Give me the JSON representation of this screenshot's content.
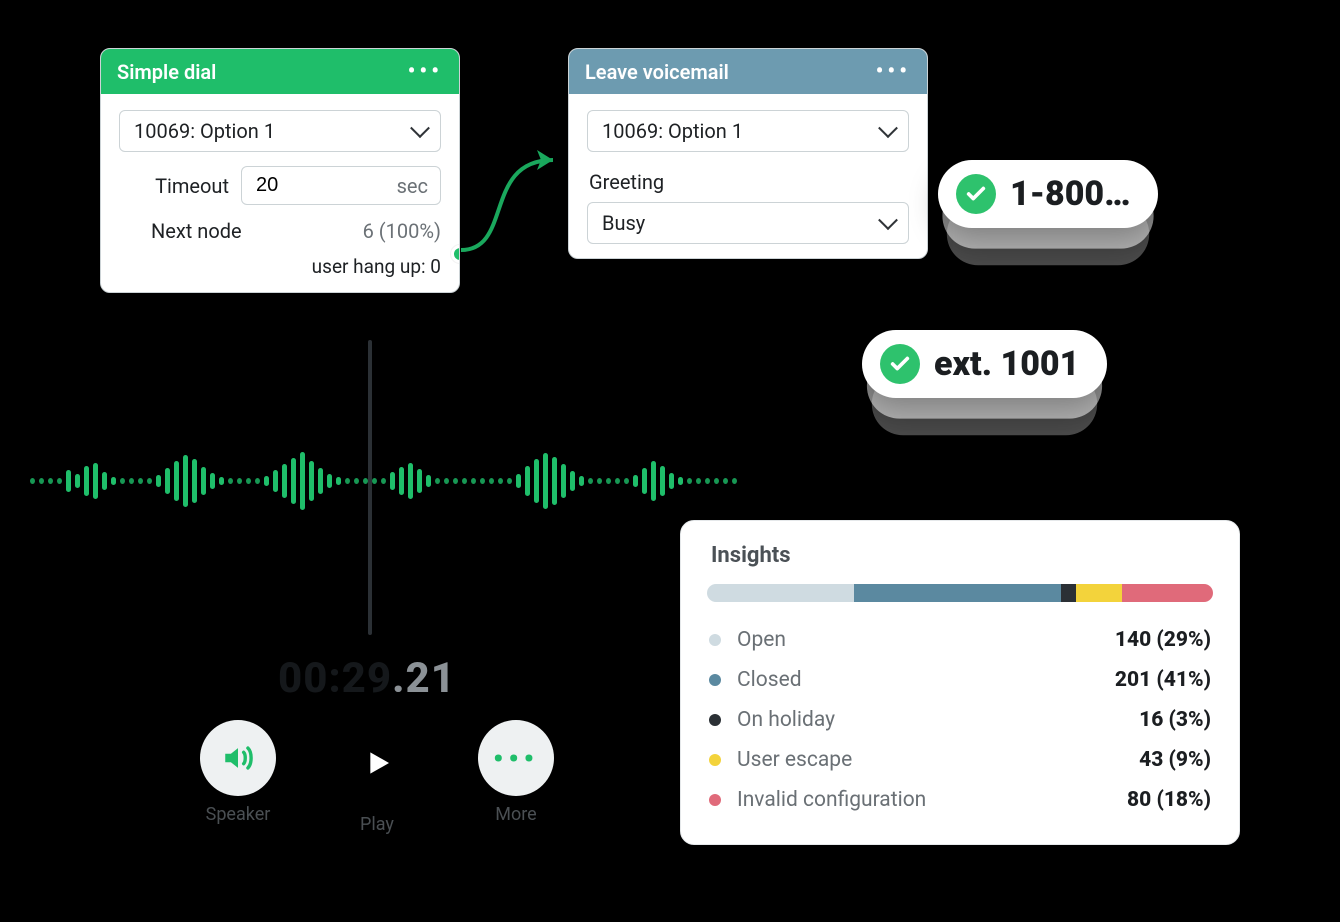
{
  "nodes": {
    "simple_dial": {
      "title": "Simple dial",
      "option": "10069: Option 1",
      "timeout_label": "Timeout",
      "timeout_value": "20",
      "timeout_unit": "sec",
      "next_node_label": "Next node",
      "next_node_value": "6 (100%)",
      "hangup": "user hang up: 0"
    },
    "voicemail": {
      "title": "Leave voicemail",
      "option": "10069: Option 1",
      "greeting_label": "Greeting",
      "greeting_value": "Busy"
    }
  },
  "pills": {
    "number": "1-800…",
    "ext": "ext. 1001"
  },
  "timer": {
    "mmss": "00:29",
    "ms": ".21"
  },
  "player": {
    "speaker": "Speaker",
    "play": "Play",
    "more": "More"
  },
  "insights": {
    "title": "Insights",
    "items": [
      {
        "name": "Open",
        "value": "140 (29%)",
        "pct": 29,
        "color": "#cfdbe1"
      },
      {
        "name": "Closed",
        "value": "201 (41%)",
        "pct": 41,
        "color": "#5b89a0"
      },
      {
        "name": "On holiday",
        "value": "16 (3%)",
        "pct": 3,
        "color": "#2b3035"
      },
      {
        "name": "User escape",
        "value": "43 (9%)",
        "pct": 9,
        "color": "#f3d33b"
      },
      {
        "name": "Invalid configuration",
        "value": "80 (18%)",
        "pct": 18,
        "color": "#e06a7a"
      }
    ]
  },
  "chart_data": {
    "type": "bar",
    "title": "Insights",
    "categories": [
      "Open",
      "Closed",
      "On holiday",
      "User escape",
      "Invalid configuration"
    ],
    "values": [
      140,
      201,
      16,
      43,
      80
    ],
    "percentages": [
      29,
      41,
      3,
      9,
      18
    ],
    "colors": [
      "#cfdbe1",
      "#5b89a0",
      "#2b3035",
      "#f3d33b",
      "#e06a7a"
    ]
  }
}
